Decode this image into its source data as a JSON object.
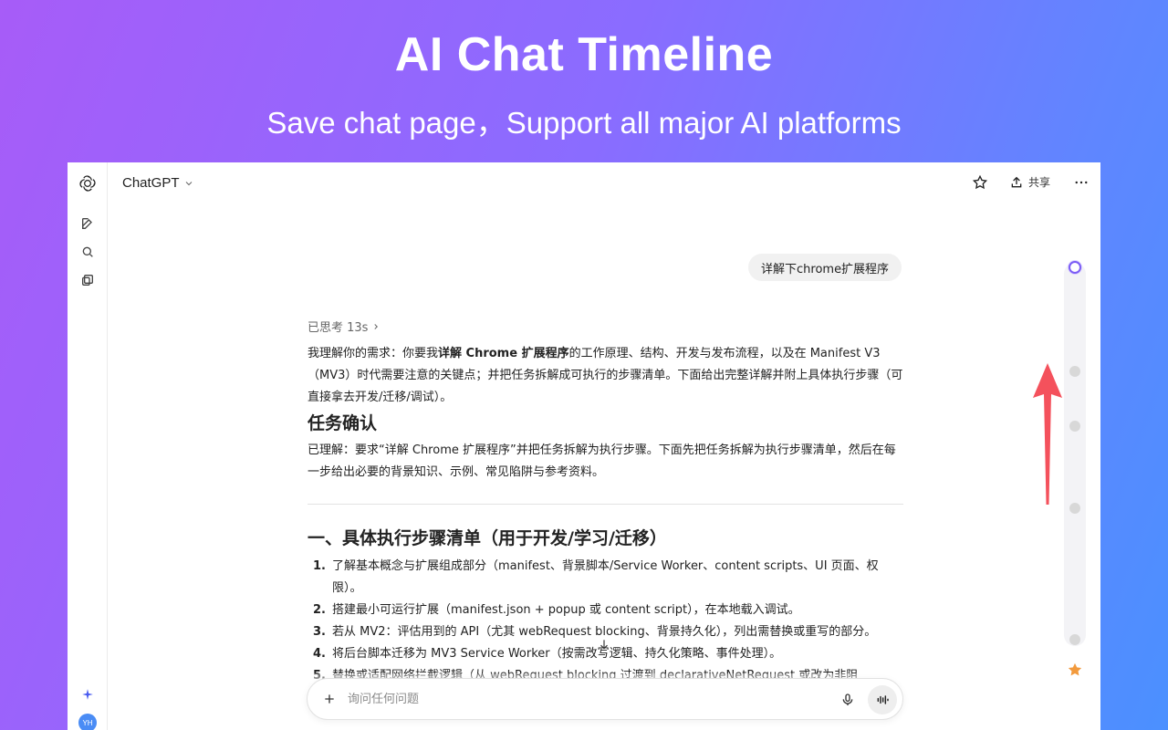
{
  "hero": {
    "title": "AI Chat Timeline",
    "subtitle": "Save chat page，Support all major AI platforms"
  },
  "app": {
    "model_name": "ChatGPT",
    "share_label": "共享",
    "avatar_initials": "YH"
  },
  "conversation": {
    "user_message": "详解下chrome扩展程序",
    "thought_label": "已思考 13s",
    "intro_before_bold": "我理解你的需求：你要我",
    "intro_bold": "详解 Chrome 扩展程序",
    "intro_after_bold": "的工作原理、结构、开发与发布流程，以及在 Manifest V3（MV3）时代需要注意的关键点；并把任务拆解成可执行的步骤清单。下面给出完整详解并附上具体执行步骤（可直接拿去开发/迁移/调试）。",
    "section_confirm_title": "任务确认",
    "section_confirm_text": "已理解：要求“详解 Chrome 扩展程序”并把任务拆解为执行步骤。下面先把任务拆解为执行步骤清单，然后在每一步给出必要的背景知识、示例、常见陷阱与参考资料。",
    "section_steps_title": "一、具体执行步骤清单（用于开发/学习/迁移）",
    "steps": [
      {
        "num": "1.",
        "text": "了解基本概念与扩展组成部分（manifest、背景脚本/Service Worker、content scripts、UI 页面、权限）。"
      },
      {
        "num": "2.",
        "text": "搭建最小可运行扩展（manifest.json + popup 或 content script），在本地载入调试。"
      },
      {
        "num": "3.",
        "text": "若从 MV2：评估用到的 API（尤其 webRequest blocking、背景持久化），列出需替换或重写的部分。"
      },
      {
        "num": "4.",
        "text": "将后台脚本迁移为 MV3 Service Worker（按需改写逻辑、持久化策略、事件处理）。"
      },
      {
        "num": "5.",
        "text": "替换或适配网络拦截逻辑（从 webRequest blocking 过渡到 declarativeNetRequest 或改为非阻"
      }
    ]
  },
  "composer": {
    "placeholder": "询问任何问题"
  },
  "colors": {
    "accent": "#7b5cf5",
    "arrow": "#f4515c",
    "star": "#f29a3d"
  },
  "icons": [
    "chatgpt-logo-icon",
    "new-chat-icon",
    "search-icon",
    "library-icon",
    "sparkle-icon",
    "star-icon",
    "share-icon",
    "more-icon",
    "plus-icon",
    "mic-icon",
    "voice-icon",
    "arrow-down-icon"
  ]
}
